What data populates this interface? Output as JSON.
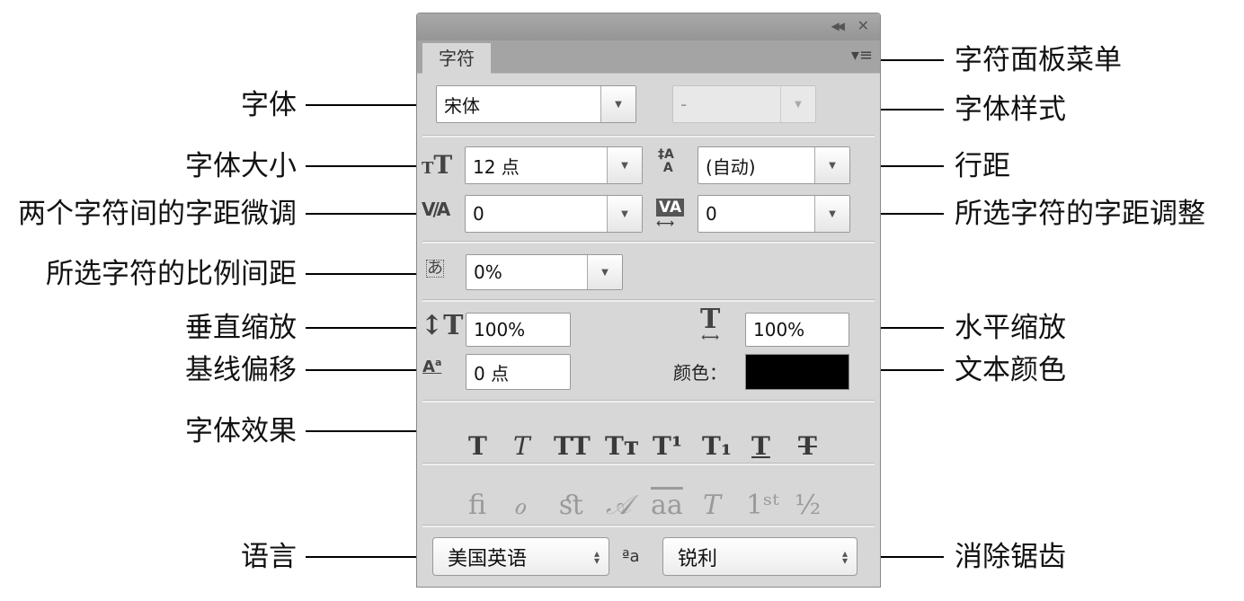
{
  "panel": {
    "tab": "字符",
    "font_family": "宋体",
    "font_style": "-",
    "font_size": "12 点",
    "leading": "(自动)",
    "kerning": "0",
    "tracking": "0",
    "tsume": "0%",
    "vertical_scale": "100%",
    "horizontal_scale": "100%",
    "baseline_shift": "0 点",
    "color_label": "颜色：",
    "color_value": "#000000",
    "effects": [
      "T",
      "T",
      "TT",
      "Tт",
      "T¹",
      "T₁",
      "T",
      "T"
    ],
    "opentype": [
      "ﬁ",
      "ℴ",
      "ﬆ",
      "𝒜",
      "aa",
      "T",
      "1ˢᵗ",
      "½"
    ],
    "language": "美国英语",
    "antialias_icon": "ªa",
    "antialias": "锐利"
  },
  "callouts": {
    "left": [
      "字体",
      "字体大小",
      "两个字符间的字距微调",
      "所选字符的比例间距",
      "垂直缩放",
      "基线偏移",
      "字体效果",
      "语言"
    ],
    "right": [
      "字符面板菜单",
      "字体样式",
      "行距",
      "所选字符的字距调整",
      "水平缩放",
      "文本颜色",
      "消除锯齿"
    ]
  }
}
